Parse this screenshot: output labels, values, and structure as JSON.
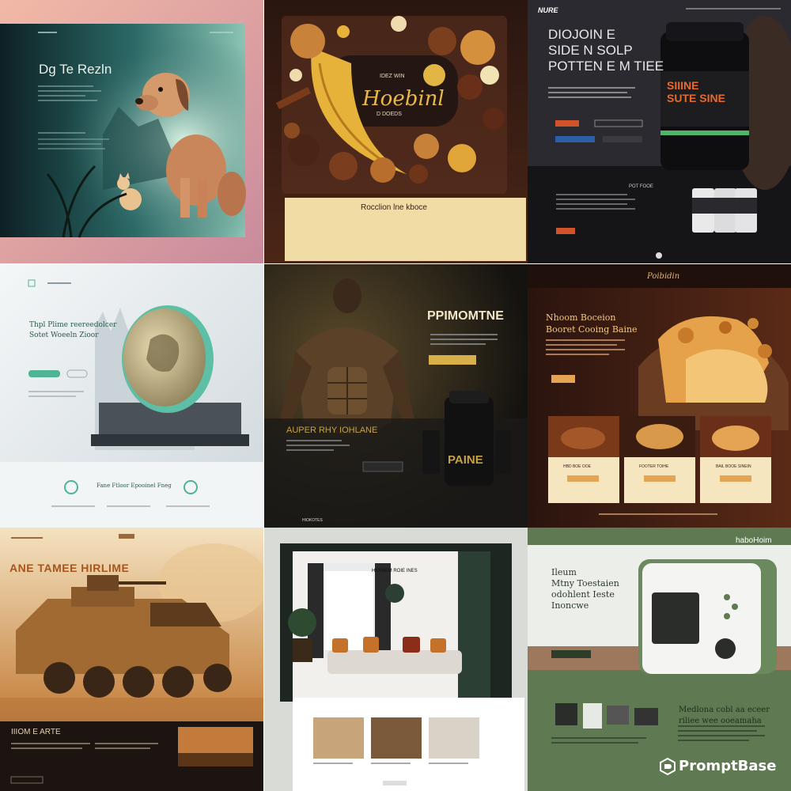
{
  "tiles": [
    {
      "name": "dog-landing",
      "title": "Dg Te Rezln"
    },
    {
      "name": "bakery-landing",
      "title": "Hoebinl",
      "eyebrow": "IDEZ WIN",
      "subtitle": "D DOEDS",
      "section": "Rocclion lne kboce"
    },
    {
      "name": "supplement-landing",
      "logo": "NURE",
      "headline": [
        "DIOJOIN E",
        "SIDE N SOLP",
        "POTTEN E M TIEE"
      ],
      "product_label": [
        "SIIINE",
        "SUTE SINE"
      ],
      "section": "POT FOOE"
    },
    {
      "name": "coin-landing",
      "headline": [
        "Thpl Plime reereedolcer",
        "Sotet Woeeln Zioor"
      ],
      "features": "Fane Ftloor Epooinel Fneg"
    },
    {
      "name": "fitness-landing",
      "title": "PPIMOMTNE",
      "banner": "AUPER RHY IOHLANE",
      "product_label": "PAINE",
      "footer": "HIOKOTES"
    },
    {
      "name": "pastry-landing",
      "script": "Poibidin",
      "headline": [
        "Nhoom Boceion",
        "Booret Cooing Baine"
      ],
      "cards": [
        "HBD BOE OOE",
        "FOOTER TOIHE",
        "BAIL BOOE SINEIN"
      ]
    },
    {
      "name": "tank-landing",
      "headline": "ANE TAMEE HIRLIME",
      "section": "IIIOM E ARTE"
    },
    {
      "name": "interior-landing",
      "header": "HERBEM ROIE INES"
    },
    {
      "name": "oven-landing",
      "brand": "haboHoim",
      "headline": [
        "Ileum",
        "Mtny Toestaien",
        "odohlent Ieste",
        "Inoncwe"
      ],
      "subheadline": [
        "Medlona cobl aa eceer",
        "riliee wee ooeamaha"
      ]
    }
  ],
  "watermark": "PromptBase",
  "colors": {
    "gold": "#c9a143",
    "green": "#2b5a4c",
    "sage": "#5f7a52"
  }
}
